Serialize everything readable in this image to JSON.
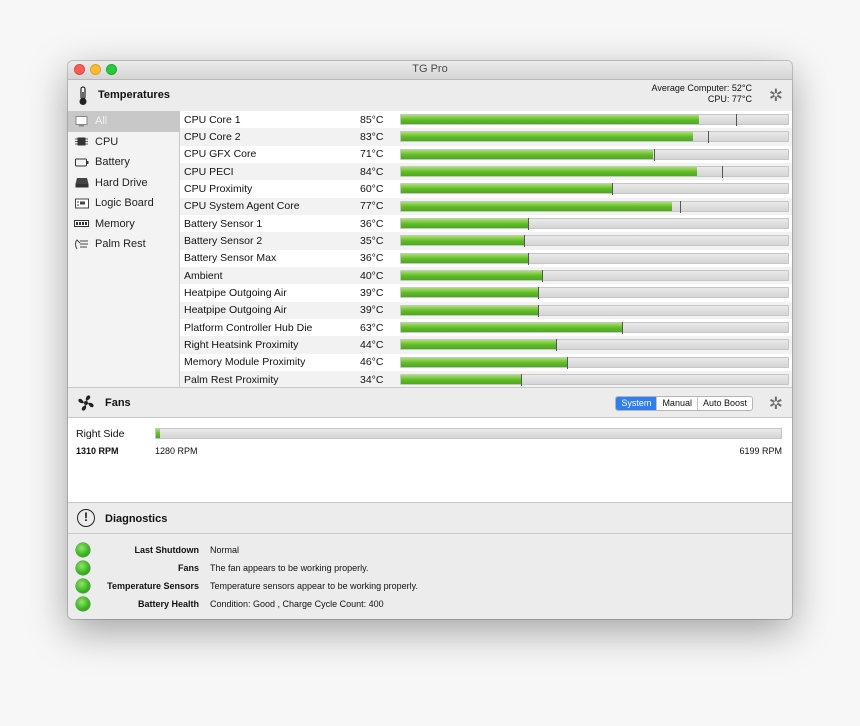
{
  "window": {
    "title": "TG Pro"
  },
  "temperatures": {
    "header": "Temperatures",
    "average_label": "Average Computer:",
    "average_value": "52°C",
    "cpu_label": "CPU:",
    "cpu_value": "77°C"
  },
  "sidebar": [
    {
      "label": "All",
      "icon": "all-icon"
    },
    {
      "label": "CPU",
      "icon": "cpu-chip-icon"
    },
    {
      "label": "Battery",
      "icon": "battery-icon"
    },
    {
      "label": "Hard Drive",
      "icon": "hard-drive-icon"
    },
    {
      "label": "Logic Board",
      "icon": "logic-board-icon"
    },
    {
      "label": "Memory",
      "icon": "memory-icon"
    },
    {
      "label": "Palm Rest",
      "icon": "palm-rest-icon"
    }
  ],
  "sensors": [
    {
      "name": "CPU Core 1",
      "temp": "85°C",
      "level": 0.77,
      "max": 0.865
    },
    {
      "name": "CPU Core 2",
      "temp": "83°C",
      "level": 0.755,
      "max": 0.792
    },
    {
      "name": "CPU GFX Core",
      "temp": "71°C",
      "level": 0.65,
      "max": 0.655
    },
    {
      "name": "CPU PECI",
      "temp": "84°C",
      "level": 0.765,
      "max": 0.83
    },
    {
      "name": "CPU Proximity",
      "temp": "60°C",
      "level": 0.545,
      "max": 0.545
    },
    {
      "name": "CPU System Agent Core",
      "temp": "77°C",
      "level": 0.7,
      "max": 0.721
    },
    {
      "name": "Battery Sensor 1",
      "temp": "36°C",
      "level": 0.328,
      "max": 0.328
    },
    {
      "name": "Battery Sensor 2",
      "temp": "35°C",
      "level": 0.318,
      "max": 0.318
    },
    {
      "name": "Battery Sensor Max",
      "temp": "36°C",
      "level": 0.328,
      "max": 0.328
    },
    {
      "name": "Ambient",
      "temp": "40°C",
      "level": 0.365,
      "max": 0.365
    },
    {
      "name": "Heatpipe Outgoing Air",
      "temp": "39°C",
      "level": 0.355,
      "max": 0.355
    },
    {
      "name": "Heatpipe Outgoing Air",
      "temp": "39°C",
      "level": 0.355,
      "max": 0.355
    },
    {
      "name": "Platform Controller Hub Die",
      "temp": "63°C",
      "level": 0.572,
      "max": 0.572
    },
    {
      "name": "Right Heatsink Proximity",
      "temp": "44°C",
      "level": 0.4,
      "max": 0.4
    },
    {
      "name": "Memory Module Proximity",
      "temp": "46°C",
      "level": 0.428,
      "max": 0.428
    },
    {
      "name": "Palm Rest Proximity",
      "temp": "34°C",
      "level": 0.31,
      "max": 0.31
    }
  ],
  "fans": {
    "header": "Fans",
    "modes": [
      "System",
      "Manual",
      "Auto Boost"
    ],
    "active_mode": "System",
    "items": [
      {
        "name": "Right Side",
        "current": "1310 RPM",
        "min": "1280 RPM",
        "max": "6199 RPM",
        "level": 0.006
      }
    ]
  },
  "diagnostics": {
    "header": "Diagnostics",
    "items": [
      {
        "label": "Last Shutdown",
        "value": "Normal",
        "status_color": "#3ab11e"
      },
      {
        "label": "Fans",
        "value": "The fan appears to be working properly.",
        "status_color": "#3ab11e"
      },
      {
        "label": "Temperature Sensors",
        "value": "Temperature sensors appear to be working properly.",
        "status_color": "#3ab11e"
      },
      {
        "label": "Battery Health",
        "value": "Condition: Good , Charge Cycle Count: 400",
        "status_color": "#3ab11e"
      }
    ]
  }
}
